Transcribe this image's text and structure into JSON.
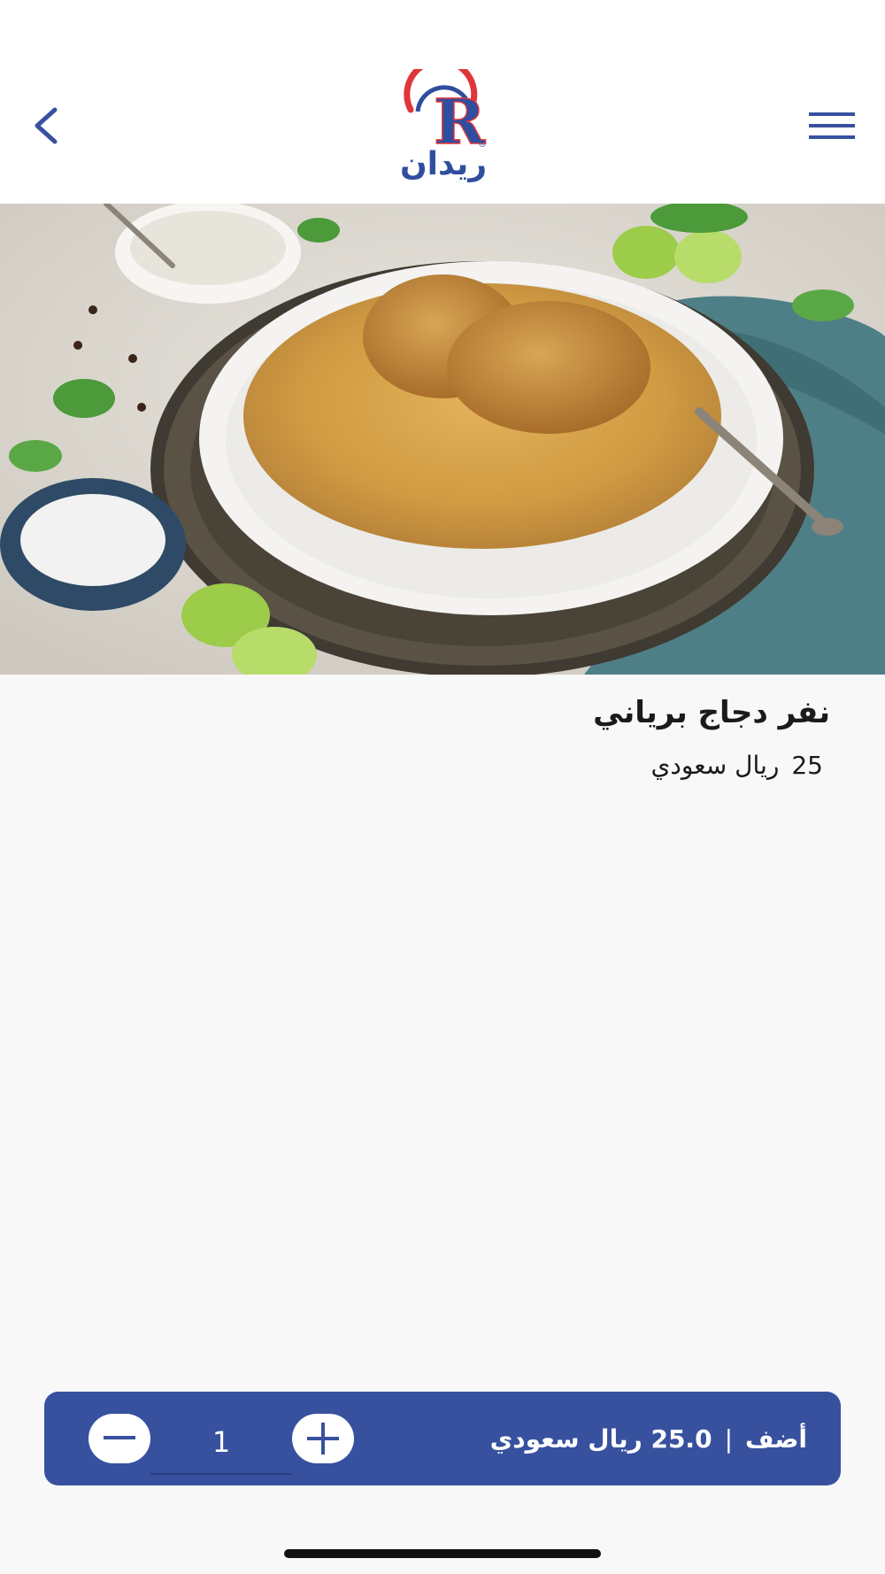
{
  "header": {
    "logo_text": "ريدان",
    "back_icon": "chevron-left-icon",
    "menu_icon": "hamburger-menu-icon",
    "accent_color": "#37519f"
  },
  "product": {
    "name": "نفر دجاج برياني",
    "price_value": "25",
    "currency": "ريال سعودي"
  },
  "cart_bar": {
    "quantity": "1",
    "add_label": "أضف",
    "separator": "|",
    "total": "25.0 ريال سعودي",
    "minus_icon": "minus-icon",
    "plus_icon": "plus-icon"
  }
}
